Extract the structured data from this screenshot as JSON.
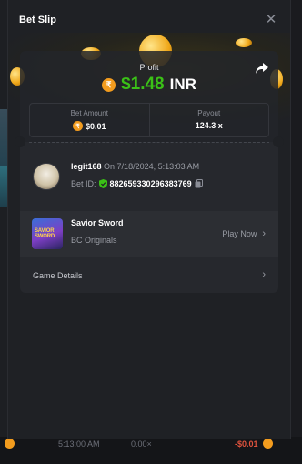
{
  "modal": {
    "title": "Bet Slip",
    "close_glyph": "✕"
  },
  "profit": {
    "label": "Profit",
    "coin_symbol": "₹",
    "value": "$1.48",
    "currency": "INR",
    "color": "#3bc117",
    "share_icon": "share-icon"
  },
  "stats": {
    "bet_amount_label": "Bet Amount",
    "bet_amount_value": "$0.01",
    "payout_label": "Payout",
    "payout_value": "124.3 x"
  },
  "user": {
    "name": "legit168",
    "date": "On 7/18/2024, 5:13:03 AM",
    "bet_id_label": "Bet ID:",
    "bet_id_value": "882659330296383769"
  },
  "game": {
    "thumb_text": "SAVIOR SWORD",
    "name": "Savior Sword",
    "provider": "BC Originals",
    "play_label": "Play Now"
  },
  "details": {
    "label": "Game Details"
  },
  "background_row": {
    "time": "5:13:00 AM",
    "multiplier": "0.00×",
    "amount": "-$0.01",
    "amount_color": "#e0533d"
  },
  "colors": {
    "accent_coin": "#f39c1e",
    "panel": "#26282d"
  }
}
